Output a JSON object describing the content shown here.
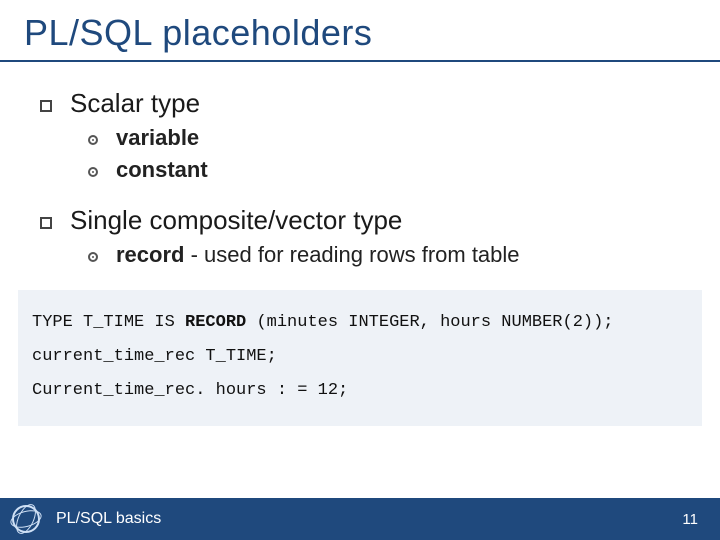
{
  "title": "PL/SQL placeholders",
  "b1": "Scalar type",
  "b1a": "variable",
  "b1b": "constant",
  "b2": "Single composite/vector type",
  "b2a_prefix": "record",
  "b2a_rest": " - used for reading rows from table",
  "code_l1_pre": "TYPE T_TIME IS ",
  "code_l1_bold": "RECORD",
  "code_l1_post": " (minutes INTEGER, hours NUMBER(2));",
  "code_l2": "current_time_rec  T_TIME;",
  "code_l3": "Current_time_rec. hours : = 12;",
  "footer_text": "PL/SQL basics",
  "page_number": "11"
}
